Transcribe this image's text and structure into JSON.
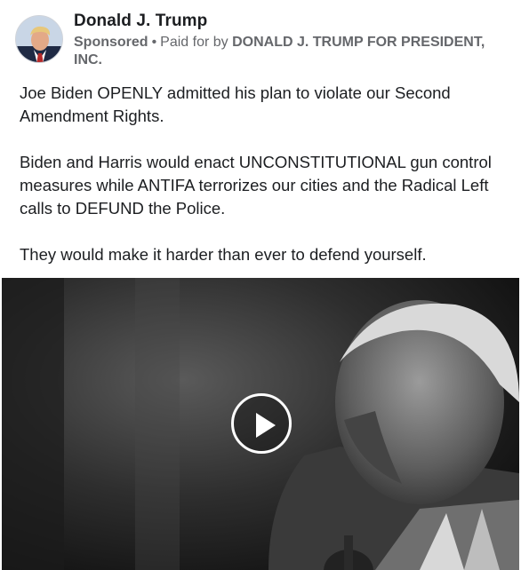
{
  "post": {
    "page_name": "Donald J. Trump",
    "sponsored_label": "Sponsored",
    "separator": "•",
    "paid_for_prefix": "Paid for by",
    "advertiser": "DONALD J. TRUMP FOR PRESIDENT, INC.",
    "body_paragraphs": [
      "Joe Biden OPENLY admitted his plan to violate our Second Amendment Rights.",
      "Biden and Harris would enact UNCONSTITUTIONAL gun control measures while ANTIFA terrorizes our cities and the Radical Left calls to DEFUND the Police.",
      "They would make it harder than ever to defend yourself."
    ],
    "video": {
      "play_icon": "play-icon"
    }
  }
}
